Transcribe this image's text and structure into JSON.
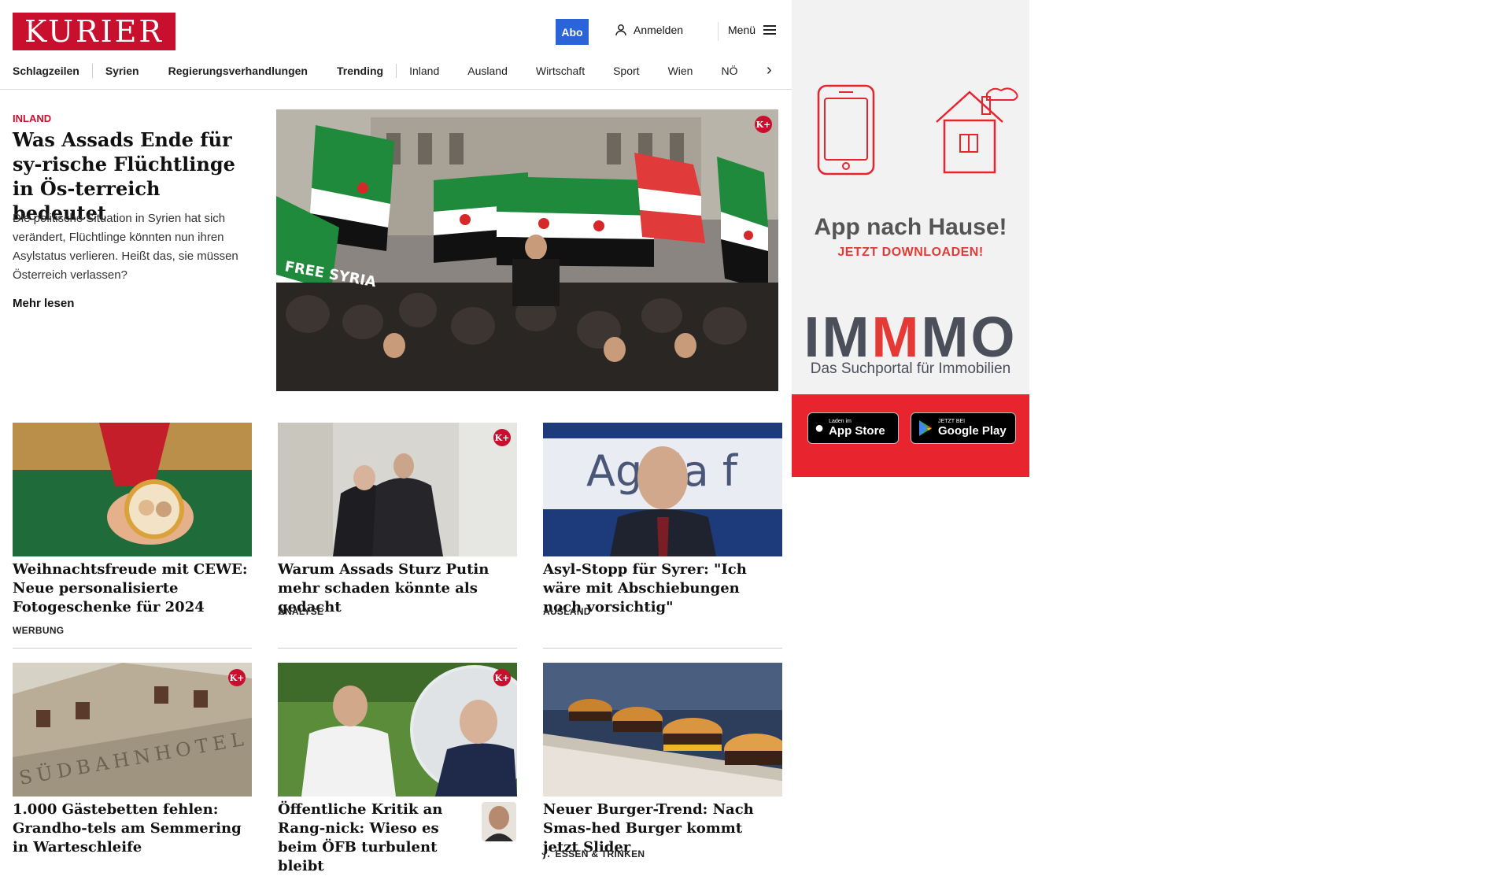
{
  "header": {
    "logo_text": "KURIER",
    "abo_label": "Abo",
    "login_label": "Anmelden",
    "menu_label": "Menü"
  },
  "nav": {
    "items": [
      "Schlagzeilen",
      "Syrien",
      "Regierungsverhandlungen",
      "Trending",
      "Inland",
      "Ausland",
      "Wirtschaft",
      "Sport",
      "Wien",
      "NÖ"
    ]
  },
  "lead": {
    "kicker": "INLAND",
    "title": "Was Assads Ende für sy-rische Flüchtlinge in Ös-terreich bedeutet",
    "teaser": "Die politische Situation in Syrien hat sich verändert, Flüchtlinge könnten nun ihren Asylstatus verlieren. Heißt das, sie müssen Österreich verlassen?",
    "more_label": "Mehr lesen",
    "badge": "K+"
  },
  "cards": [
    {
      "title": "Weihnachtsfreude mit CEWE: Neue personalisierte Fotogeschenke für 2024",
      "category": "WERBUNG"
    },
    {
      "title": "Warum Assads Sturz Putin mehr schaden könnte als gedacht",
      "category": "ANALYSE",
      "badge": "K+"
    },
    {
      "title": "Asyl-Stopp für Syrer: \"Ich wäre mit Abschiebungen noch vorsichtig\"",
      "category": "AUSLAND",
      "image_text": "Ag    da f"
    },
    {
      "title": "1.000 Gästebetten fehlen: Grandho-tels am Semmering in Warteschleife",
      "badge": "K+",
      "image_text": "SÜDBAHNHOTEL"
    },
    {
      "title": "Öffentliche Kritik an Rang-nick: Wieso es beim ÖFB turbulent bleibt",
      "badge": "K+"
    },
    {
      "title": "Neuer Burger-Trend: Nach Smas-hed Burger kommt jetzt Slider",
      "category": "ESSEN & TRINKEN"
    }
  ],
  "ad": {
    "title": "App nach Hause!",
    "cta": "JETZT DOWNLOADEN!",
    "brand_a": "IM",
    "brand_b": "M",
    "brand_c": "MO",
    "brand_sub": "Das Suchportal für Immobilien",
    "appstore_small": "Laden im",
    "appstore_big": "App Store",
    "googleplay_small": "JETZT BEI",
    "googleplay_big": "Google Play"
  },
  "lead_image_text": "FREE SYRIA",
  "colors": {
    "brand": "#c8102e",
    "abo": "#2b63d8",
    "ad_red": "#e8242f"
  }
}
